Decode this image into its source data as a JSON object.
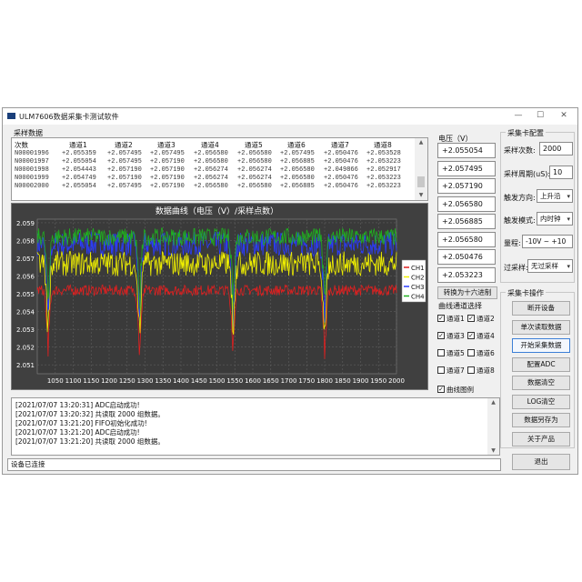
{
  "window": {
    "title": "ULM7606数据采集卡测试软件",
    "minimize": "—",
    "maximize": "☐",
    "close": "✕"
  },
  "data_table": {
    "group_title": "采样数据",
    "headers": [
      "次数",
      "通道1",
      "通道2",
      "通道3",
      "通道4",
      "通道5",
      "通道6",
      "通道7",
      "通道8"
    ],
    "rows": [
      [
        "N00001996",
        "+2.055359",
        "+2.057495",
        "+2.057495",
        "+2.056580",
        "+2.056580",
        "+2.057495",
        "+2.050476",
        "+2.053528"
      ],
      [
        "N00001997",
        "+2.055054",
        "+2.057495",
        "+2.057190",
        "+2.056580",
        "+2.056580",
        "+2.056885",
        "+2.050476",
        "+2.053223"
      ],
      [
        "N00001998",
        "+2.054443",
        "+2.057190",
        "+2.057190",
        "+2.056274",
        "+2.056274",
        "+2.056580",
        "+2.049866",
        "+2.052917"
      ],
      [
        "N00001999",
        "+2.054749",
        "+2.057190",
        "+2.057190",
        "+2.056274",
        "+2.056274",
        "+2.056580",
        "+2.050476",
        "+2.053223"
      ],
      [
        "N00002000",
        "+2.055054",
        "+2.057495",
        "+2.057190",
        "+2.056580",
        "+2.056580",
        "+2.056885",
        "+2.050476",
        "+2.053223"
      ]
    ]
  },
  "voltage": {
    "group_title": "电压（V）",
    "values": [
      "+2.055054",
      "+2.057495",
      "+2.057190",
      "+2.056580",
      "+2.056885",
      "+2.056580",
      "+2.050476",
      "+2.053223"
    ],
    "hex_button": "转换为十六进制"
  },
  "channel_select": {
    "group_title": "曲线通道选择",
    "channels": [
      {
        "label": "通道1",
        "checked": true
      },
      {
        "label": "通道2",
        "checked": true
      },
      {
        "label": "通道3",
        "checked": true
      },
      {
        "label": "通道4",
        "checked": true
      },
      {
        "label": "通道5",
        "checked": false
      },
      {
        "label": "通道6",
        "checked": false
      },
      {
        "label": "通道7",
        "checked": false
      },
      {
        "label": "通道8",
        "checked": false
      }
    ],
    "legend_toggle": {
      "label": "曲线图例",
      "checked": true
    }
  },
  "config": {
    "group_title": "采集卡配置",
    "sample_count_label": "采样次数:",
    "sample_count": "2000",
    "sample_period_label": "采样周期(uS):",
    "sample_period": "10",
    "trigger_dir_label": "触发方向:",
    "trigger_dir": "上升沿",
    "trigger_mode_label": "触发模式:",
    "trigger_mode": "内时钟",
    "range_label": "量程:",
    "range": "-10V ~ +10",
    "oversample_label": "过采样:",
    "oversample": "无过采样"
  },
  "operations": {
    "group_title": "采集卡操作",
    "buttons": [
      "断开设备",
      "单次读取数据",
      "开始采集数据",
      "配置ADC",
      "数据清空",
      "LOG清空",
      "数据另存为",
      "关于产品"
    ],
    "exit": "退出"
  },
  "log": [
    "[2021/07/07 13:20:31] ADC启动成功!",
    "[2021/07/07 13:20:32] 共读取 2000 组数据。",
    "[2021/07/07 13:21:20] FIFO初始化成功!",
    "[2021/07/07 13:21:20] ADC启动成功!",
    "[2021/07/07 13:21:20] 共读取 2000 组数据。"
  ],
  "status_text": "设备已连接",
  "chart_data": {
    "type": "line",
    "title": "数据曲线（电压（V）/采样点数）",
    "xlim": [
      1000,
      2000
    ],
    "ylim": [
      2.0505,
      2.0592
    ],
    "x_ticks": [
      1050,
      1100,
      1150,
      1200,
      1250,
      1300,
      1350,
      1400,
      1450,
      1500,
      1550,
      1600,
      1650,
      1700,
      1750,
      1800,
      1850,
      1900,
      1950,
      2000
    ],
    "y_ticks": [
      "2.059",
      "2.058",
      "2.057",
      "2.056",
      "2.055",
      "2.054",
      "2.053",
      "2.052",
      "2.051"
    ],
    "grid": true,
    "legend_position": "right",
    "background": "#3a3a3a",
    "dips_at": [
      1030,
      1285,
      1545,
      1800
    ],
    "series": [
      {
        "name": "CH1",
        "color": "#e02020",
        "base": 2.0552,
        "noise": 0.0003,
        "dip": 2.0506
      },
      {
        "name": "CH2",
        "color": "#f0f000",
        "base": 2.0567,
        "noise": 0.0007,
        "dip": 2.0511
      },
      {
        "name": "CH3",
        "color": "#2a3cff",
        "base": 2.0578,
        "noise": 0.0007,
        "dip": 2.0525
      },
      {
        "name": "CH4",
        "color": "#20b020",
        "base": 2.0582,
        "noise": 0.0005,
        "dip": 2.0535
      }
    ]
  }
}
